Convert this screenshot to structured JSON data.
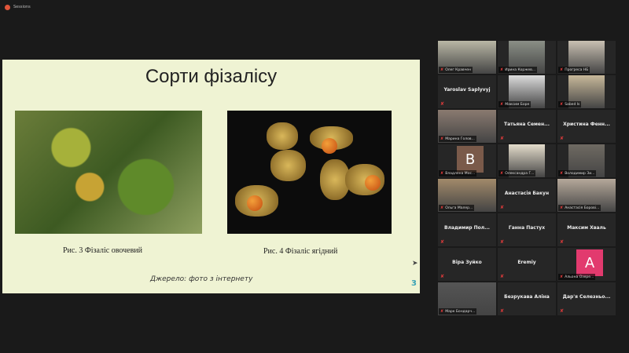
{
  "window": {
    "title": "Sessions"
  },
  "slide": {
    "title": "Сорти фізалісу",
    "caption_left": "Рис. 3 Фізаліс овочевий",
    "caption_right": "Рис. 4 Фізаліс ягідний",
    "source": "Джерело: фото з інтернету",
    "page_number": "3"
  },
  "participants": [
    {
      "name": "Олег Кравчен",
      "type": "video",
      "color": "#b9b7a5"
    },
    {
      "name": "Ирина Коржев...",
      "type": "video",
      "color": "#8a8f86"
    },
    {
      "name": "Прогреса НБ",
      "type": "video",
      "color": "#c9c0b2"
    },
    {
      "name": "Yaroslav Saplyvyj",
      "type": "name"
    },
    {
      "name": "Максим Боре",
      "type": "video",
      "color": "#dcdcdc"
    },
    {
      "name": "Sabed Is",
      "type": "video",
      "color": "#c7b89a"
    },
    {
      "name": "Марина Голов...",
      "type": "video",
      "color": "#8a7a70"
    },
    {
      "name": "Татьяна Семен...",
      "type": "name"
    },
    {
      "name": "Христина Фенн...",
      "type": "name"
    },
    {
      "name": "Владлена Мос...",
      "type": "avatar",
      "letter": "B",
      "color": "#7a5a4a"
    },
    {
      "name": "Олександра Г...",
      "type": "video",
      "color": "#e4dccb"
    },
    {
      "name": "Володимир Зи...",
      "type": "video",
      "color": "#6f6a62"
    },
    {
      "name": "Ольга Малер...",
      "type": "video",
      "color": "#a28a6a"
    },
    {
      "name": "Анастасія Бакун",
      "type": "name"
    },
    {
      "name": "Анастасія Борові...",
      "type": "video",
      "color": "#b5a89a",
      "active": true
    },
    {
      "name": "Владимир Пол...",
      "type": "name"
    },
    {
      "name": "Ганна Пастух",
      "type": "name"
    },
    {
      "name": "Максим Хваль",
      "type": "name"
    },
    {
      "name": "Віра Зуйко",
      "type": "name"
    },
    {
      "name": "Eremiy",
      "type": "name"
    },
    {
      "name": "Альона Озере...",
      "type": "avatar",
      "letter": "A",
      "color": "#e23a6e"
    },
    {
      "name": "Марк Бондарч...",
      "type": "video",
      "color": "#555"
    },
    {
      "name": "Безрукава Аліна",
      "type": "name"
    },
    {
      "name": "Дар'я Селезньо...",
      "type": "name"
    }
  ]
}
